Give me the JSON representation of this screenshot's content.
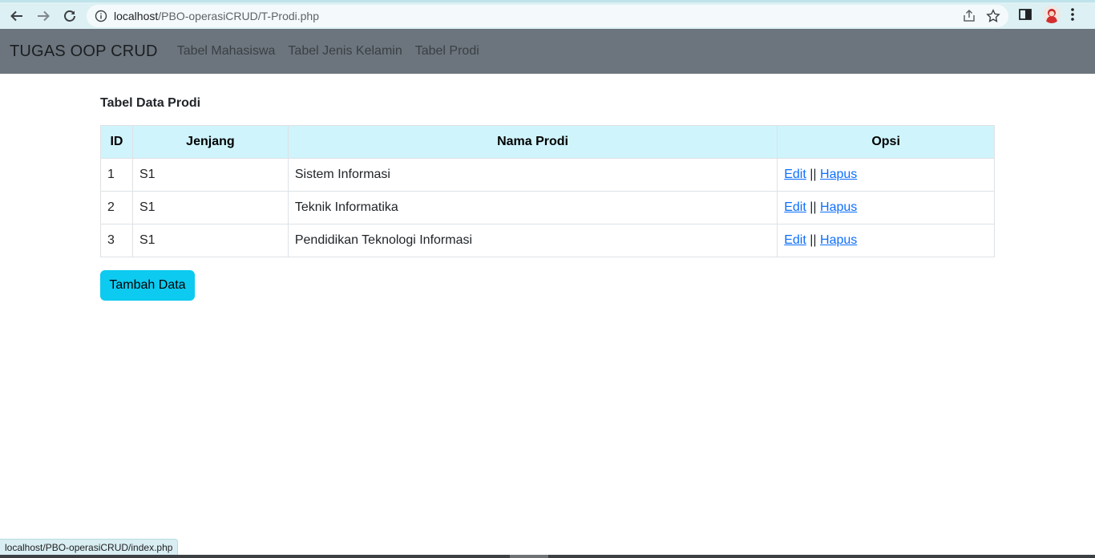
{
  "browser": {
    "url_host": "localhost",
    "url_path": "/PBO-operasiCRUD/T-Prodi.php",
    "status_url": "localhost/PBO-operasiCRUD/index.php"
  },
  "navbar": {
    "brand": "TUGAS OOP CRUD",
    "links": [
      "Tabel Mahasiswa",
      "Tabel Jenis Kelamin",
      "Tabel Prodi"
    ]
  },
  "main": {
    "title": "Tabel Data Prodi",
    "table": {
      "headers": [
        "ID",
        "Jenjang",
        "Nama Prodi",
        "Opsi"
      ],
      "rows": [
        {
          "id": "1",
          "jenjang": "S1",
          "nama": "Sistem Informasi",
          "edit": "Edit",
          "sep": "||",
          "hapus": "Hapus"
        },
        {
          "id": "2",
          "jenjang": "S1",
          "nama": "Teknik Informatika",
          "edit": "Edit",
          "sep": "||",
          "hapus": "Hapus"
        },
        {
          "id": "3",
          "jenjang": "S1",
          "nama": "Pendidikan Teknologi Informasi",
          "edit": "Edit",
          "sep": "||",
          "hapus": "Hapus"
        }
      ]
    },
    "add_button": "Tambah Data"
  },
  "colors": {
    "navbar_bg": "#6c757d",
    "table_header_bg": "#cff4fc",
    "button_bg": "#0dcaf0",
    "link": "#0d6efd"
  },
  "icons": [
    "back-arrow-icon",
    "forward-arrow-icon",
    "reload-icon",
    "info-icon",
    "share-icon",
    "star-icon",
    "side-panel-icon",
    "kebab-menu-icon"
  ]
}
